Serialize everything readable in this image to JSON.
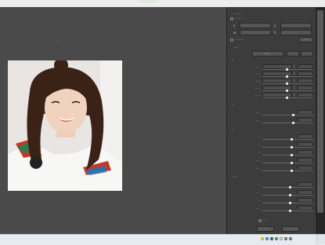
{
  "window": {
    "title": ""
  },
  "canvas": {
    "image_label": "··"
  },
  "panel": {
    "header": "·· ····",
    "group_top": {
      "title": "·· ··· ·",
      "x_label": "x",
      "y_label": "y",
      "w_label": "w",
      "h_label": "h"
    },
    "group_mid_title": "·· ·····",
    "apply_button": "···",
    "preset_label": "·····",
    "preset_value": "··· ·",
    "section_1": "··",
    "rows_1": [
      {
        "label": "····"
      },
      {
        "label": "····"
      },
      {
        "label": "····"
      },
      {
        "label": "·· ··"
      },
      {
        "label": "·· ··"
      }
    ],
    "section_2": "··",
    "rows_2": [
      {
        "label": "····"
      },
      {
        "label": "····"
      }
    ],
    "section_3": "··",
    "rows_3": [
      {
        "label": "··"
      },
      {
        "label": "··"
      },
      {
        "label": "··"
      },
      {
        "label": "····"
      },
      {
        "label": "····"
      }
    ],
    "section_4": "·· ··",
    "rows_4": [
      {
        "label": "··"
      },
      {
        "label": "·· ·"
      },
      {
        "label": "··"
      },
      {
        "label": "····"
      }
    ],
    "footer_label": "·· ··",
    "ok_button": "··",
    "cancel_button": "··"
  },
  "taskbar": {
    "time": "",
    "date": ""
  }
}
